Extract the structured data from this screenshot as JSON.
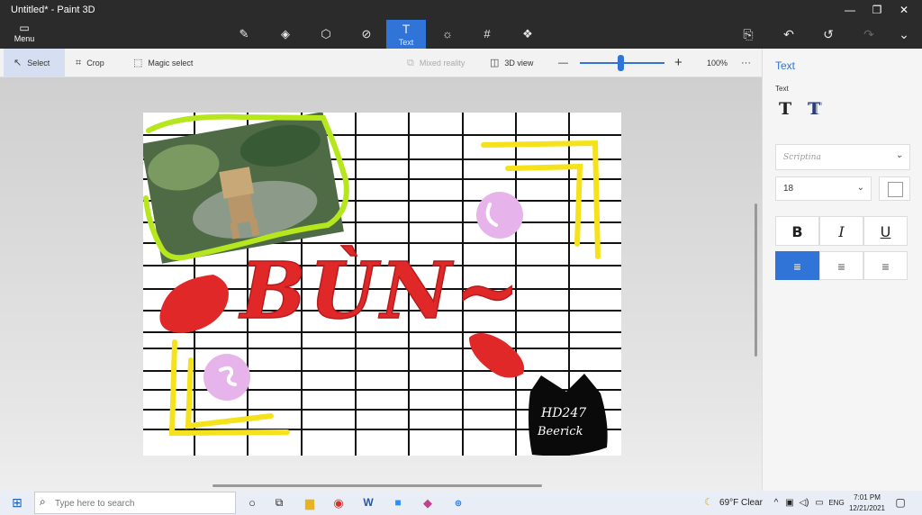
{
  "window": {
    "title": "Untitled* - Paint 3D"
  },
  "toolbar": {
    "menu_label": "Menu",
    "active_tool_label": "Text"
  },
  "commandbar": {
    "select": "Select",
    "crop": "Crop",
    "magic_select": "Magic select",
    "mixed_reality": "Mixed reality",
    "view_3d": "3D view",
    "zoom_minus": "—",
    "zoom_plus": "+",
    "zoom_level": "100%",
    "more": "···"
  },
  "canvas_art": {
    "letters": "BÙN~",
    "signature_line1": "HD247",
    "signature_line2": "Beerick"
  },
  "panel": {
    "title": "Text",
    "section_label": "Text",
    "font_value": "Scriptina",
    "font_size": "18",
    "bold": "B",
    "italic": "I",
    "underline": "U"
  },
  "taskbar": {
    "search_placeholder": "Type here to search",
    "weather": "69°F  Clear",
    "language": "ENG",
    "time": "7:01 PM",
    "date": "12/21/2021"
  },
  "colors": {
    "accent": "#2f74d6",
    "dark_bar": "#2b2b2b",
    "paint_red": "#e02828",
    "paint_yellow": "#f5e21a",
    "paint_green": "#b6e61e",
    "paint_pink": "#e6b4ea"
  }
}
